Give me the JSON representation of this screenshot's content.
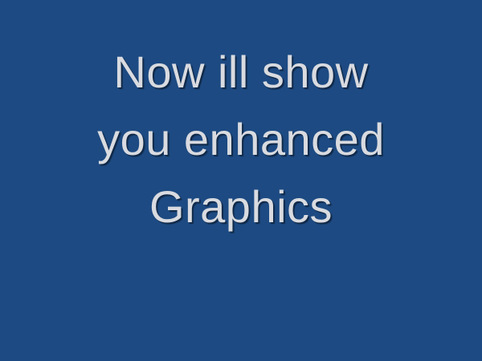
{
  "slide": {
    "background": "#1d4a82",
    "text_color": "#d9dbe0",
    "title_lines": [
      "Now ill show",
      "you enhanced",
      "Graphics"
    ]
  }
}
